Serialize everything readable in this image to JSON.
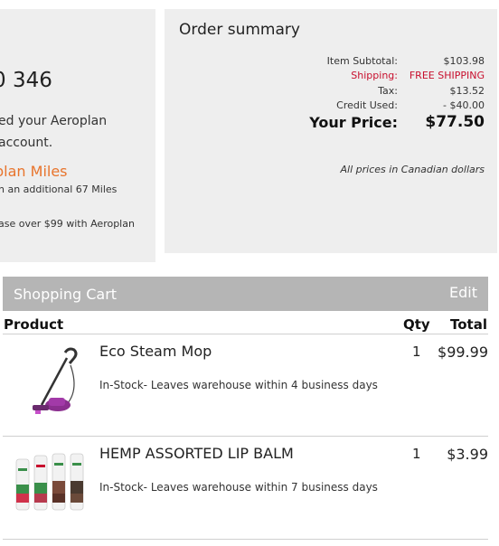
{
  "aeroplan": {
    "points": "0 346",
    "line1": "ed your Aeroplan",
    "line2": "account.",
    "miles": "plan Miles",
    "additional": "n an additional 67 Miles",
    "purchase_note": "ase over $99 with Aeroplan"
  },
  "order_summary": {
    "title": "Order summary",
    "rows": [
      {
        "label": "Item Subtotal:",
        "value": "$103.98"
      },
      {
        "label": "Shipping:",
        "value": "FREE SHIPPING"
      },
      {
        "label": "Tax:",
        "value": "$13.52"
      },
      {
        "label": "Credit Used:",
        "value": "- $40.00"
      }
    ],
    "total_label": "Your Price:",
    "total_value": "$77.50",
    "note": "All prices in Canadian dollars",
    "shipping_color": "#c8102e"
  },
  "cart": {
    "title": "Shopping Cart",
    "edit_label": "Edit",
    "columns": {
      "product": "Product",
      "qty": "Qty",
      "total": "Total"
    },
    "items": [
      {
        "name": "Eco Steam Mop",
        "stock": "In-Stock- Leaves warehouse within 4 business days",
        "qty": "1",
        "price": "$99.99",
        "icon": "steam-mop-image"
      },
      {
        "name": "HEMP ASSORTED LIP BALM",
        "stock": "In-Stock- Leaves warehouse within 7 business days",
        "qty": "1",
        "price": "$3.99",
        "icon": "lip-balm-image"
      }
    ]
  },
  "colors": {
    "accent_orange": "#e8742c",
    "bar_gray": "#b5b5b5",
    "panel_gray": "#eeeeee"
  }
}
